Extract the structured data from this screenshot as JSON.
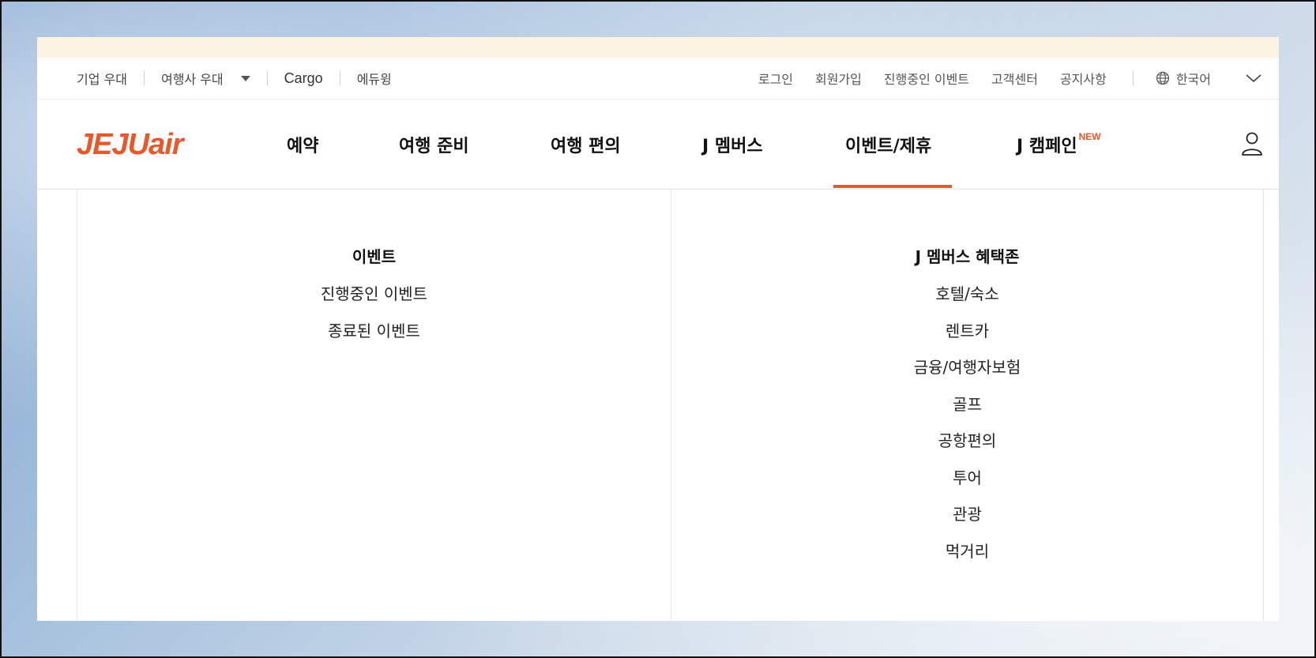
{
  "utility_bar": {
    "left_items": [
      "기업 우대",
      "여행사 우대",
      "Cargo",
      "에듀윙"
    ],
    "right_links": [
      "로그인",
      "회원가입",
      "진행중인 이벤트",
      "고객센터",
      "공지사항"
    ],
    "language": "한국어"
  },
  "header": {
    "logo_main": "JEJU",
    "logo_sub": "air",
    "nav": [
      {
        "label": "예약"
      },
      {
        "label": "여행 준비"
      },
      {
        "label": "여행 편의"
      },
      {
        "label": "J 멤버스"
      },
      {
        "label": "이벤트/제휴",
        "active": true
      },
      {
        "label": "J 캠페인",
        "badge": "NEW"
      }
    ],
    "accent_color": "#e8582a"
  },
  "mega_menu": {
    "columns": [
      {
        "title": "이벤트",
        "items": [
          "진행중인 이벤트",
          "종료된 이벤트"
        ]
      },
      {
        "title": "J 멤버스 혜택존",
        "items": [
          "호텔/숙소",
          "렌트카",
          "금융/여행자보험",
          "골프",
          "공항편의",
          "투어",
          "관광",
          "먹거리"
        ]
      }
    ]
  },
  "icons": {
    "dropdown": "caret-down-icon",
    "language": "globe-icon",
    "expand": "chevron-down-icon",
    "account": "user-icon"
  }
}
